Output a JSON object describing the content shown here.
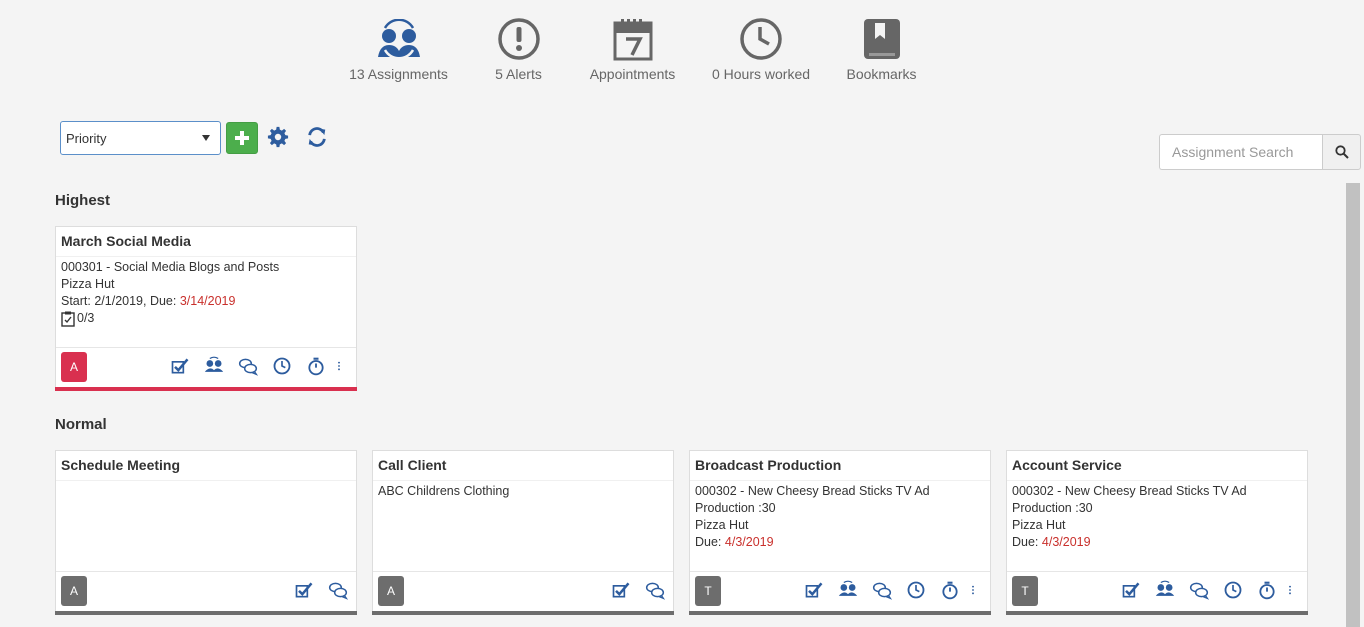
{
  "topnav": {
    "assignments": "13 Assignments",
    "alerts": "5 Alerts",
    "appointments": "Appointments",
    "hours": "0 Hours worked",
    "bookmarks": "Bookmarks"
  },
  "toolbar": {
    "sort_value": "Priority",
    "search_placeholder": "Assignment Search"
  },
  "colors": {
    "icon_blue": "#2d5c9e",
    "gray_icon": "#666666",
    "green": "#4cae4c",
    "red": "#d9304f",
    "gray_avatar": "#6d6d6d",
    "due_red": "#c9302c"
  },
  "sections": {
    "highest": "Highest",
    "normal": "Normal"
  },
  "cards": [
    {
      "title": "March Social Media",
      "line1": "000301 - Social Media Blogs and Posts",
      "line2": "Pizza Hut",
      "start": "Start: 2/1/2019,  Due: ",
      "due": "3/14/2019",
      "checklist": "0/3",
      "avatar": "A"
    },
    {
      "title": "Schedule Meeting",
      "avatar": "A"
    },
    {
      "title": "Call Client",
      "line1": "ABC Childrens Clothing",
      "avatar": "A"
    },
    {
      "title": "Broadcast Production",
      "line1": "000302 - New Cheesy Bread Sticks TV Ad",
      "line2": "Production :30",
      "line3": "Pizza Hut",
      "due_label": "Due: ",
      "due": "4/3/2019",
      "avatar": "T"
    },
    {
      "title": "Account Service",
      "line1": "000302 - New Cheesy Bread Sticks TV Ad",
      "line2": "Production :30",
      "line3": "Pizza Hut",
      "due_label": "Due: ",
      "due": "4/3/2019",
      "avatar": "T"
    }
  ]
}
